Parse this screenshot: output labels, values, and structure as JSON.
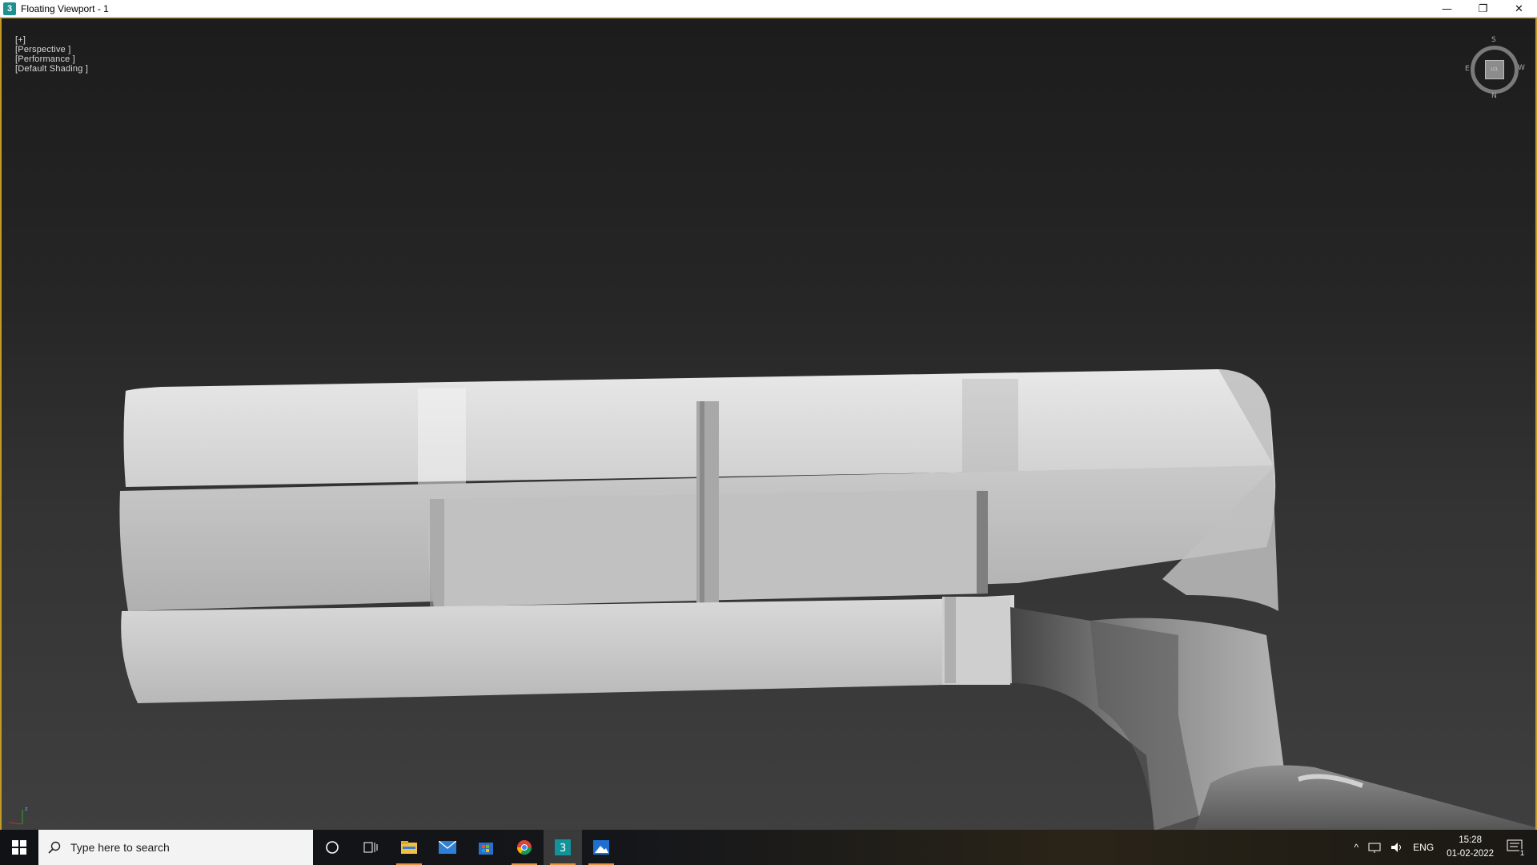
{
  "window": {
    "title": "Floating Viewport - 1",
    "app_icon": "3"
  },
  "controls": {
    "minimize": "—",
    "restore": "❐",
    "close": "✕"
  },
  "viewport": {
    "labels": [
      "[+]",
      "[Perspective ]",
      "[Performance ]",
      "[Default Shading ]"
    ],
    "viewcube": {
      "n": "N",
      "s": "S",
      "e": "E",
      "w": "W",
      "face": "LCL"
    },
    "axis": {
      "z": "z",
      "x": "x"
    }
  },
  "taskbar": {
    "search_placeholder": "Type here to search",
    "icons": [
      "cortana-icon",
      "task-view-icon",
      "file-explorer-icon",
      "mail-icon",
      "store-icon",
      "chrome-icon",
      "3ds-max-icon",
      "photos-icon"
    ],
    "tray": {
      "language": "ENG",
      "time": "15:28",
      "date": "01-02-2022",
      "notifications": "1"
    }
  }
}
